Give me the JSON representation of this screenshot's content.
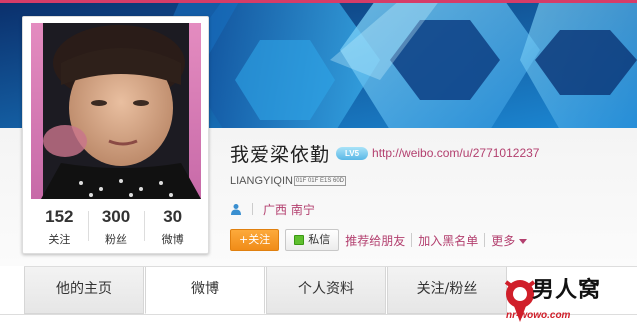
{
  "profile": {
    "name": "我爱梁依勤",
    "level_badge": "LV5",
    "url": "http://weibo.com/u/2771012237",
    "domain": "LIANGYIQIN",
    "domain_glyph": "01F 01F E1S 60D",
    "location": "广西 南宁"
  },
  "stats": [
    {
      "value": "152",
      "label": "关注"
    },
    {
      "value": "300",
      "label": "粉丝"
    },
    {
      "value": "30",
      "label": "微博"
    }
  ],
  "actions": {
    "follow": "+关注",
    "message": "私信",
    "recommend": "推荐给朋友",
    "blacklist": "加入黑名单",
    "more": "更多"
  },
  "tabs": [
    {
      "label": "他的主页",
      "active": false
    },
    {
      "label": "微博",
      "active": true
    },
    {
      "label": "个人资料",
      "active": false
    },
    {
      "label": "关注/粉丝",
      "active": false
    }
  ],
  "watermark": {
    "text": "男人窝",
    "url": "nr-wowo.com"
  },
  "colors": {
    "link": "#b3406f",
    "follow_button": "#f5941f",
    "banner_accent": "#5ec6f2"
  }
}
